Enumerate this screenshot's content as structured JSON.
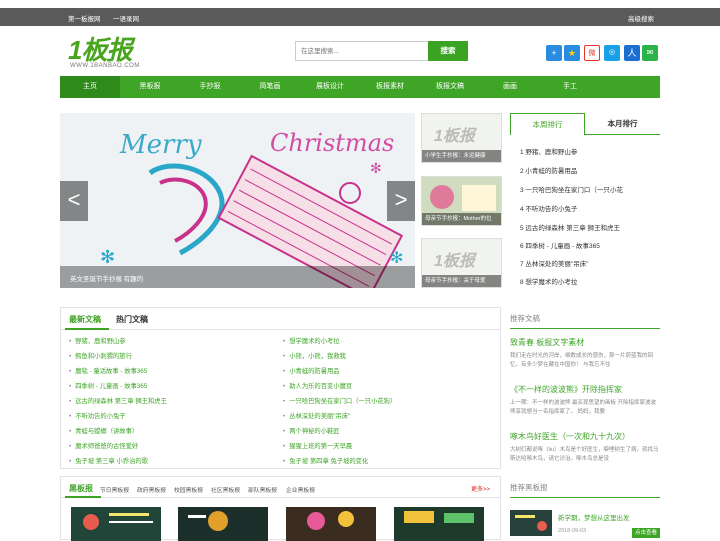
{
  "topbar": {
    "left_links": [
      "第一板报网",
      "一语录网"
    ],
    "right_link": "高级搜索"
  },
  "logo": {
    "mark": "1板报",
    "url": "WWW.1BANBAO.COM"
  },
  "search": {
    "placeholder": "在这里搜索...",
    "button": "搜索"
  },
  "nav": [
    "主页",
    "黑板报",
    "手抄报",
    "简笔画",
    "展板设计",
    "板报素材",
    "板报文稿",
    "画画",
    "手工"
  ],
  "slider": {
    "caption": "英文圣诞节手抄报 有趣的",
    "prev": "<",
    "next": ">"
  },
  "thumbs": [
    {
      "caption": "小学生手抄报：永远健康",
      "logo": "1板报"
    },
    {
      "caption": "母亲节手抄报：Mother的位",
      "logo": ""
    },
    {
      "caption": "母亲节手抄报：关于母爱",
      "logo": "1板报"
    }
  ],
  "ranking": {
    "tabs": [
      "本周排行",
      "本月排行"
    ],
    "items": [
      "1  野猪、鹿和野山参",
      "2  小青蛙的防暑用品",
      "3  一只哈巴狗坐在家门口（一只小花",
      "4  不听劝告的小兔子",
      "5  远古的绿森林 第三章 狮王和虎王",
      "6  四季树 - 儿童画 - 故事365",
      "7  丛林深处的美丽\"吊床\"",
      "8  想学魔术的小考拉"
    ]
  },
  "news": {
    "tabs": [
      "最新文稿",
      "热门文稿"
    ],
    "left": [
      "野猪、鹿和野山参",
      "鳄鱼和小刺猬的旅行",
      "魔毯 - 童话故事 - 故事365",
      "四季树 - 儿童画 - 故事365",
      "远古的绿森林 第三章 狮王和虎王",
      "不听劝告的小兔子",
      "青蛙与螳螂（讲故事）",
      "魔术师爸爸的古怪爱好",
      "兔子坡 第三章 小乔治的歌"
    ],
    "right": [
      "想学魔术的小考拉",
      "小熊，小熊，我救我",
      "小青蛙的防暑用品",
      "助人为乐的百变小魔豆",
      "一只哈巴狗坐在家门口（一只小花狗）",
      "丛林深处的美丽\"吊床\"",
      "两个神秘的小鞋匠",
      "猩猩上班的第一天早晨",
      "兔子坡 第四章 兔子坡的变化"
    ]
  },
  "recommend": {
    "heading": "推荐文稿",
    "items": [
      {
        "title": "致青春 板报文字素材",
        "desc": "我们走在时光的河岸，细数成长的感伤，那一片蔚蓝我的回忆，有多少梦在藏在中国你！ 与我忘不住"
      },
      {
        "title": "《不一样的波波熊》开除指挥家",
        "desc": "上一期：不一样的波波熊 最买现思望的画板 开除指挥家波波熊享就想当一名指挥家了。 妈妈，我要"
      },
      {
        "title": "啄木鸟好医生（一次和九十九次）",
        "desc": "大树们都说啄（liu）木鸟是个好医生，噼哩树生了病，就找马斯达哈啄木鸟，请它诊治。啄木鸟总是没"
      }
    ]
  },
  "heiban": {
    "heading": "黑板报",
    "subs": [
      "节日黑板报",
      "政府黑板报",
      "校园黑板报",
      "社区黑板报",
      "部队黑板报",
      "企业黑板报"
    ],
    "more": "更多>>"
  },
  "tuijian": {
    "heading": "推荐黑板报",
    "title": "新学期，梦想从这里出发",
    "date": "2018-09-03",
    "button": "点击查看"
  },
  "colors": {
    "brand": "#3fa527",
    "topbar": "#5a5a5a",
    "nav_active": "#2f8a1c"
  },
  "icons": [
    "plus-icon",
    "star-icon",
    "weibo-icon",
    "chat-icon",
    "renren-icon",
    "wechat-icon"
  ]
}
